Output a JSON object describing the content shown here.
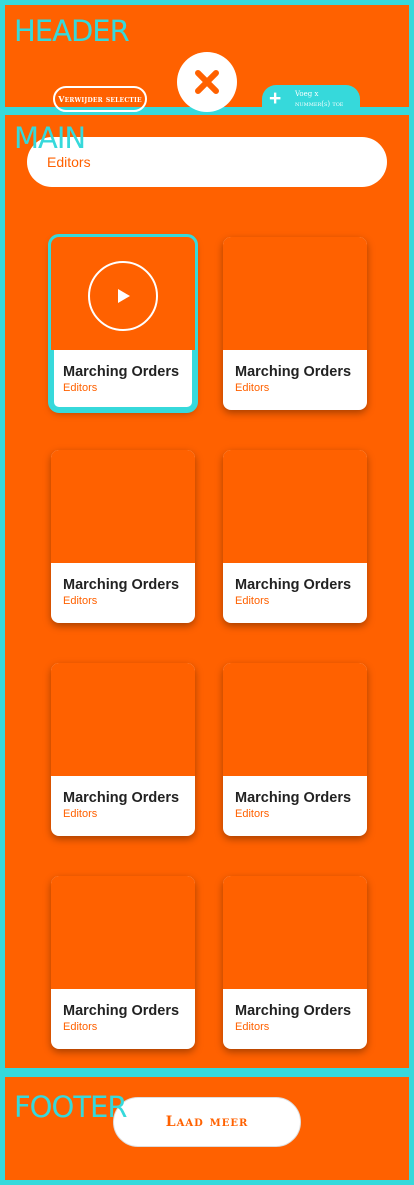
{
  "header": {
    "label": "HEADER",
    "remove_selection": "Verwijder selectie",
    "add_line1": "Voeg x",
    "add_line2": "nummer(s) toe"
  },
  "main": {
    "label": "MAIN",
    "search_value": "Editors",
    "cards": [
      {
        "title": "Marching Orders",
        "artist": "Editors"
      },
      {
        "title": "Marching Orders",
        "artist": "Editors"
      },
      {
        "title": "Marching Orders",
        "artist": "Editors"
      },
      {
        "title": "Marching Orders",
        "artist": "Editors"
      },
      {
        "title": "Marching Orders",
        "artist": "Editors"
      },
      {
        "title": "Marching Orders",
        "artist": "Editors"
      },
      {
        "title": "Marching Orders",
        "artist": "Editors"
      },
      {
        "title": "Marching Orders",
        "artist": "Editors"
      }
    ]
  },
  "footer": {
    "label": "FOOTER",
    "load_more": "Laad meer"
  },
  "colors": {
    "accent": "#ff6100",
    "highlight": "#36d9db"
  },
  "icons": {
    "close": "close-icon",
    "add": "plus-icon",
    "play": "play-icon"
  }
}
